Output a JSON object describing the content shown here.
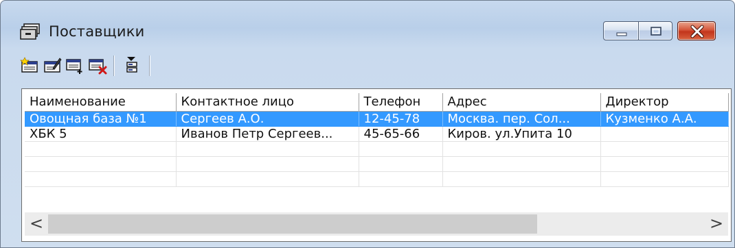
{
  "window": {
    "title": "Поставщики",
    "icon": "cabinet-icon",
    "controls": [
      "minimize-icon",
      "maximize-icon",
      "close-icon"
    ]
  },
  "toolbar": {
    "buttons": [
      {
        "name": "add-record",
        "icon": "new-record-icon"
      },
      {
        "name": "edit-record",
        "icon": "edit-record-icon"
      },
      {
        "name": "insert-record",
        "icon": "insert-record-icon"
      },
      {
        "name": "delete-record",
        "icon": "delete-record-icon"
      },
      {
        "name": "filter",
        "icon": "filter-icon"
      }
    ]
  },
  "grid": {
    "columns": [
      "Наименование",
      "Контактное лицо",
      "Телефон",
      "Адрес",
      "Директор"
    ],
    "rows": [
      [
        "Овощная база №1",
        "Сергеев А.О.",
        "12-45-78",
        "Москва. пер. Сол...",
        "Кузменко А.А."
      ],
      [
        "ХБК 5",
        "Иванов Петр Сергеев...",
        "45-65-66",
        "Киров. ул.Упита 10",
        ""
      ],
      [
        "",
        "",
        "",
        "",
        ""
      ],
      [
        "",
        "",
        "",
        "",
        ""
      ],
      [
        "",
        "",
        "",
        "",
        ""
      ]
    ],
    "selected_row": 0,
    "scroll": {
      "left_arrow": "<",
      "right_arrow": ">"
    }
  },
  "colors": {
    "selection": "#3399ff",
    "frame": "#c9daee",
    "close_button": "#c9432a"
  }
}
